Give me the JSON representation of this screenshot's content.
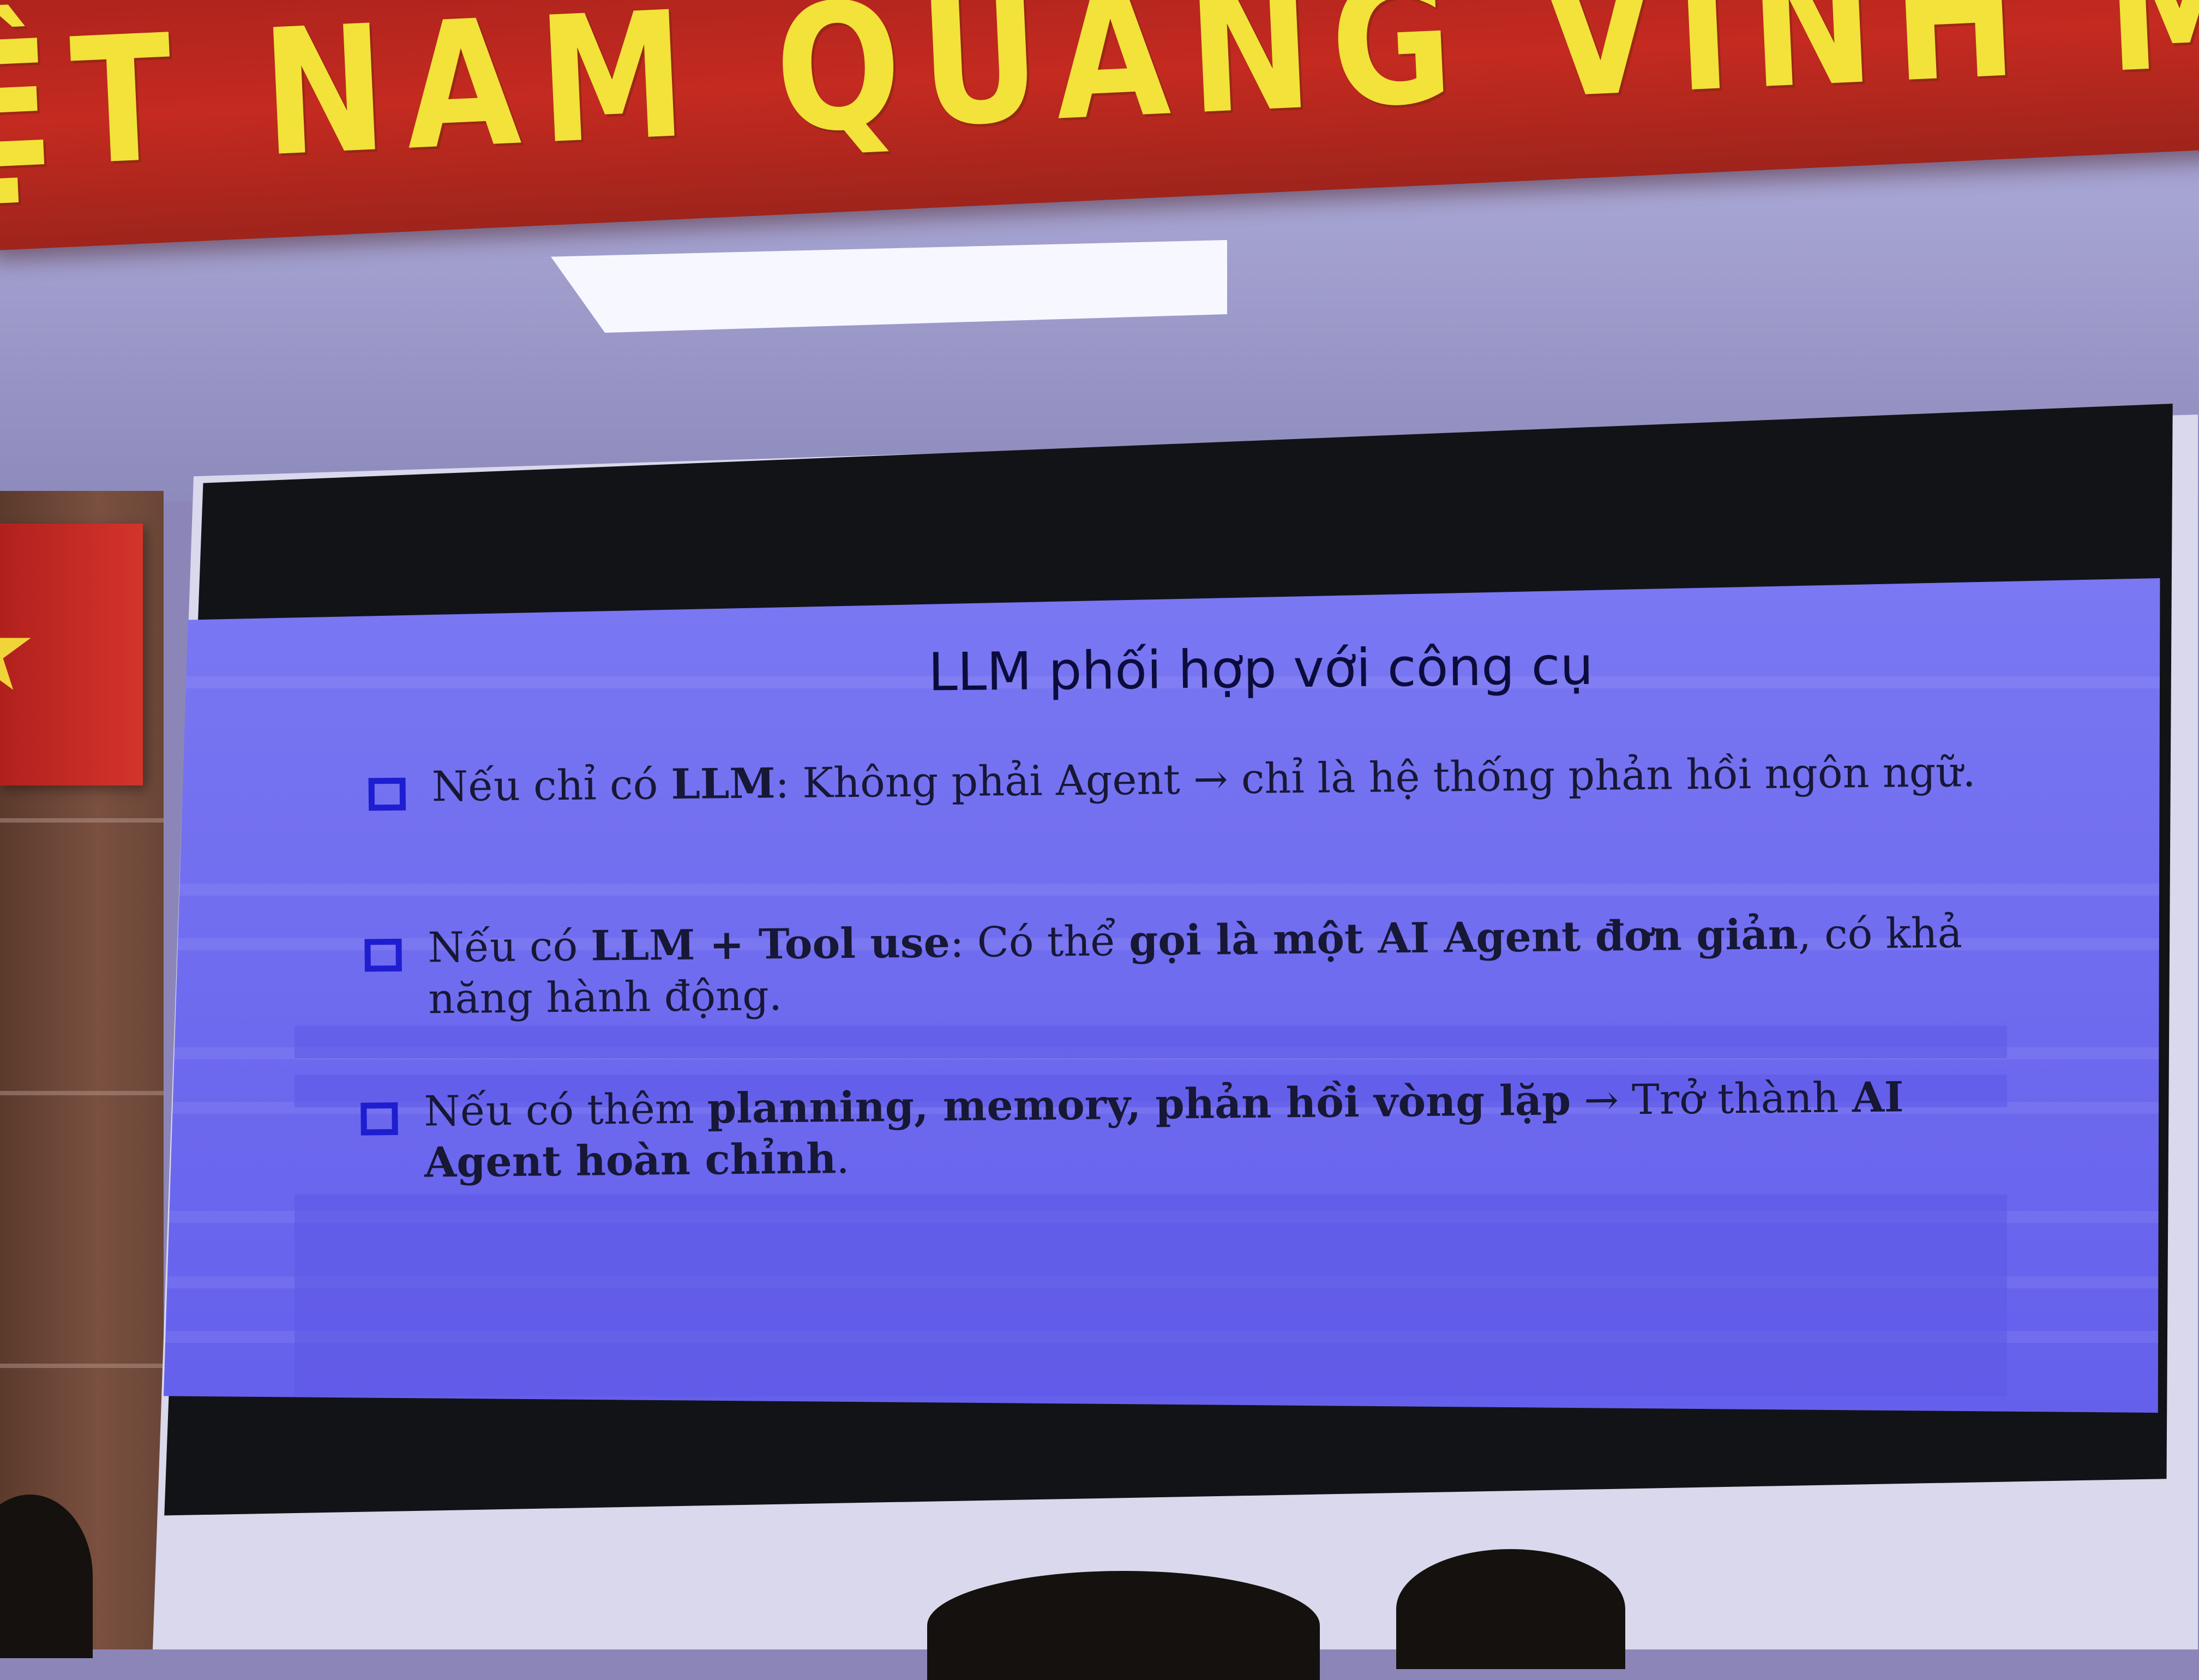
{
  "banner": {
    "text": "ỆT NAM QUANG VINH MUÔN N"
  },
  "slide": {
    "title": "LLM phối hợp với công cụ",
    "bullets": [
      {
        "part1": "Nếu chỉ có ",
        "bold1": "LLM",
        "part2": ": Không phải Agent → chỉ là hệ thống phản hồi ngôn ngữ."
      },
      {
        "part1": "Nếu có ",
        "bold1": "LLM + Tool use",
        "part2": ": Có thể ",
        "bold2": "gọi là một AI Agent đơn giản",
        "part3": ", có khả năng hành động."
      },
      {
        "part1": "Nếu có thêm ",
        "bold1": "planning, memory, phản hồi vòng lặp",
        "part2": " → Trở thành ",
        "bold2": "AI Agent hoàn chỉnh",
        "part3": "."
      }
    ]
  },
  "colors": {
    "banner_red": "#c42a20",
    "banner_text_yellow": "#f3e23a",
    "slide_background": "#7a78f2",
    "bullet_box_blue": "#1e1ed0",
    "slide_text": "#171736"
  }
}
